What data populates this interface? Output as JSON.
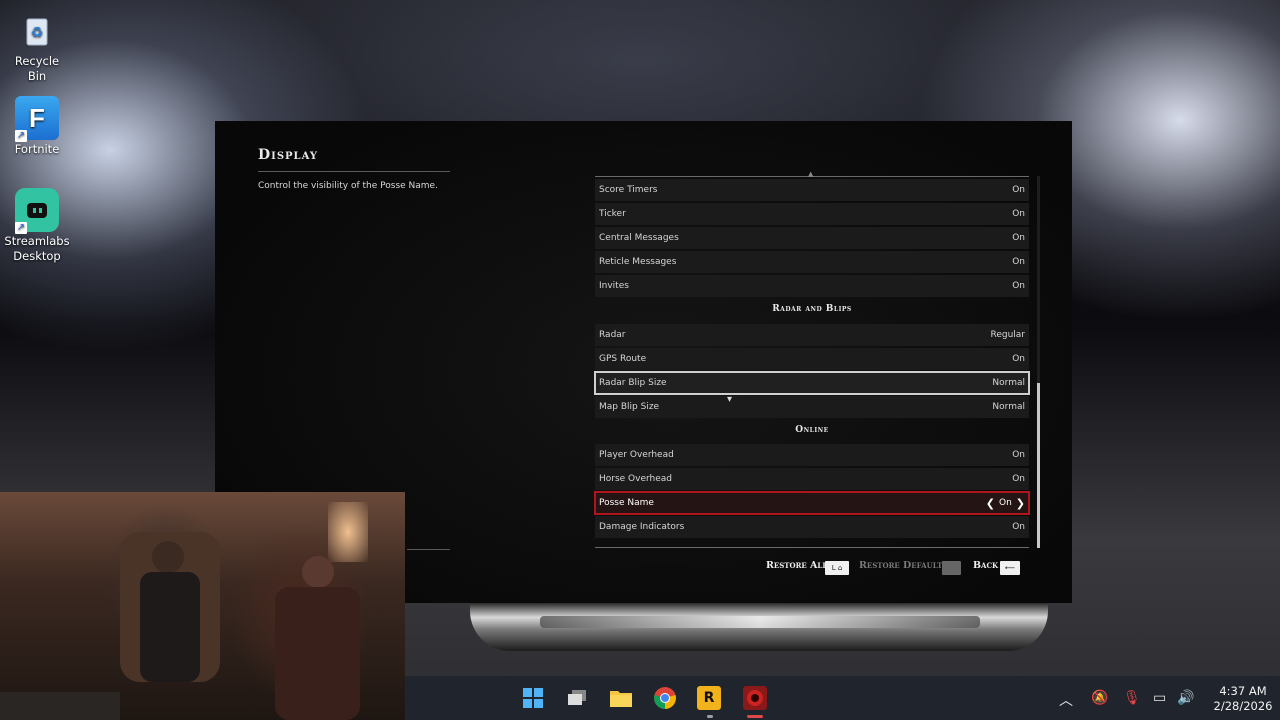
{
  "desktop": {
    "icons": [
      {
        "label": "Recycle Bin"
      },
      {
        "label": "Fortnite"
      },
      {
        "label": "Streamlabs Desktop"
      }
    ]
  },
  "game": {
    "title": "Display",
    "description": "Control the visibility of the Posse Name.",
    "rows": [
      {
        "label": "Score Timers",
        "value": "On"
      },
      {
        "label": "Ticker",
        "value": "On"
      },
      {
        "label": "Central Messages",
        "value": "On"
      },
      {
        "label": "Reticle Messages",
        "value": "On"
      },
      {
        "label": "Invites",
        "value": "On"
      }
    ],
    "section_radar": "Radar and Blips",
    "radar_rows": [
      {
        "label": "Radar",
        "value": "Regular"
      },
      {
        "label": "GPS Route",
        "value": "On"
      },
      {
        "label": "Radar Blip Size",
        "value": "Normal"
      },
      {
        "label": "Map Blip Size",
        "value": "Normal"
      }
    ],
    "section_online": "Online",
    "online_rows": [
      {
        "label": "Player Overhead",
        "value": "On"
      },
      {
        "label": "Horse Overhead",
        "value": "On"
      },
      {
        "label": "Posse Name",
        "value": "On"
      },
      {
        "label": "Damage Indicators",
        "value": "On"
      }
    ],
    "footer": {
      "restore_all": "Restore All",
      "restore_all_key": "L ⌂",
      "restore_default": "Restore Default",
      "back": "Back",
      "back_key": "⟵"
    }
  },
  "taskbar": {
    "time": "4:37 AM",
    "date": "2/28/2026",
    "colors": {
      "accent": "#b0141c",
      "taskbar": "#20242c"
    }
  }
}
